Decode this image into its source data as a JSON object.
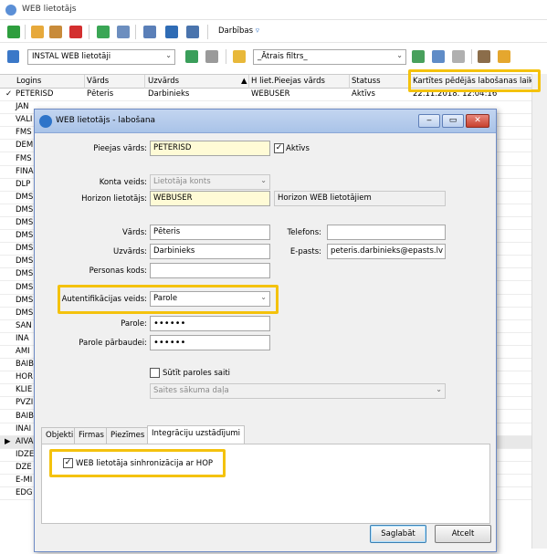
{
  "main_window": {
    "title": "WEB lietotājs"
  },
  "toolbar1": {
    "actions_label": "Darbības"
  },
  "toolbar2": {
    "source_combo": "INSTAL WEB lietotāji",
    "filter_combo": "_Ātrais filtrs_"
  },
  "grid": {
    "columns": [
      "Logins",
      "Vārds",
      "Uzvārds",
      "H liet.Pieejas vārds",
      "Statuss",
      "Kartītes pēdējās labošanas laiks"
    ],
    "sort_indicator": "▲",
    "first_row": {
      "mark": "✓",
      "login": "PETERISD",
      "vards": "Pēteris",
      "uzvards": "Darbinieks",
      "h_vards": "WEBUSER",
      "statuss": "Aktīvs",
      "laiks": "22.11.2018. 12:04:16"
    },
    "logins": [
      "JAN",
      "VALI",
      "FMS",
      "DEM",
      "FMS",
      "FINA",
      "DLP",
      "DMS",
      "DMS",
      "DMS",
      "DMS",
      "DMS",
      "DMS",
      "DMS",
      "DMS",
      "DMS",
      "DMS",
      "SAN",
      "INA",
      "AMI",
      "BAIB",
      "HOR",
      "KLIE",
      "PVZI",
      "BAIB",
      "INAI",
      "AIVA",
      "IDZE",
      "DZE",
      "E-MI",
      "EDG"
    ],
    "current_row_mark": "▶"
  },
  "dialog": {
    "title": "WEB lietotājs - labošana",
    "window_buttons": [
      "‒",
      "▭",
      "✕"
    ],
    "pieejas_vards": {
      "label": "Pieejas vārds:",
      "value": "PETERISD"
    },
    "aktivs": {
      "label": "Aktīvs",
      "checked": true
    },
    "konta_veids": {
      "label": "Konta veids:",
      "value": "Lietotāja konts"
    },
    "horizon": {
      "label": "Horizon lietotājs:",
      "value": "WEBUSER",
      "description": "Horizon WEB lietotājiem"
    },
    "vards": {
      "label": "Vārds:",
      "value": "Pēteris"
    },
    "telefons": {
      "label": "Telefons:",
      "value": ""
    },
    "uzvards": {
      "label": "Uzvārds:",
      "value": "Darbinieks"
    },
    "epasts": {
      "label": "E-pasts:",
      "value": "peteris.darbinieks@epasts.lv"
    },
    "personas_kods": {
      "label": "Personas kods:",
      "value": ""
    },
    "autentifikacija": {
      "label": "Autentifikācijas veids:",
      "value": "Parole"
    },
    "parole": {
      "label": "Parole:",
      "value": "••••••"
    },
    "parole2": {
      "label": "Parole pārbaudei:",
      "value": "••••••"
    },
    "sutit_paroles_saiti": {
      "label": "Sūtīt paroles saiti",
      "checked": false
    },
    "saites_sakuma_dala": {
      "placeholder": "Saites sākuma daļa"
    },
    "tabs": [
      "Objekti",
      "Firmas",
      "Piezīmes",
      "Integrāciju uzstādījumi"
    ],
    "active_tab": "Integrāciju uzstādījumi",
    "sync": {
      "label": "WEB lietotāja sinhronizācija ar HOP",
      "checked": true
    },
    "save_label": "Saglabāt",
    "cancel_label": "Atcelt"
  },
  "colors": {
    "highlight": "#f4c20d",
    "required_field": "#fffbd6",
    "title_bar": "#a9c3e8"
  }
}
